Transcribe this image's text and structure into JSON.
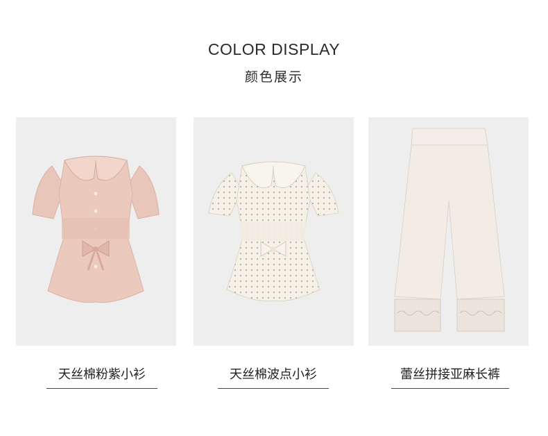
{
  "header": {
    "title_en": "COLOR DISPLAY",
    "title_cn": "颜色展示"
  },
  "products": [
    {
      "name": "天丝棉粉紫小衫",
      "color": "#e8c4b8"
    },
    {
      "name": "天丝棉波点小衫",
      "color": "#f4f0e6"
    },
    {
      "name": "蕾丝拼接亚麻长裤",
      "color": "#f1ebe4"
    }
  ]
}
